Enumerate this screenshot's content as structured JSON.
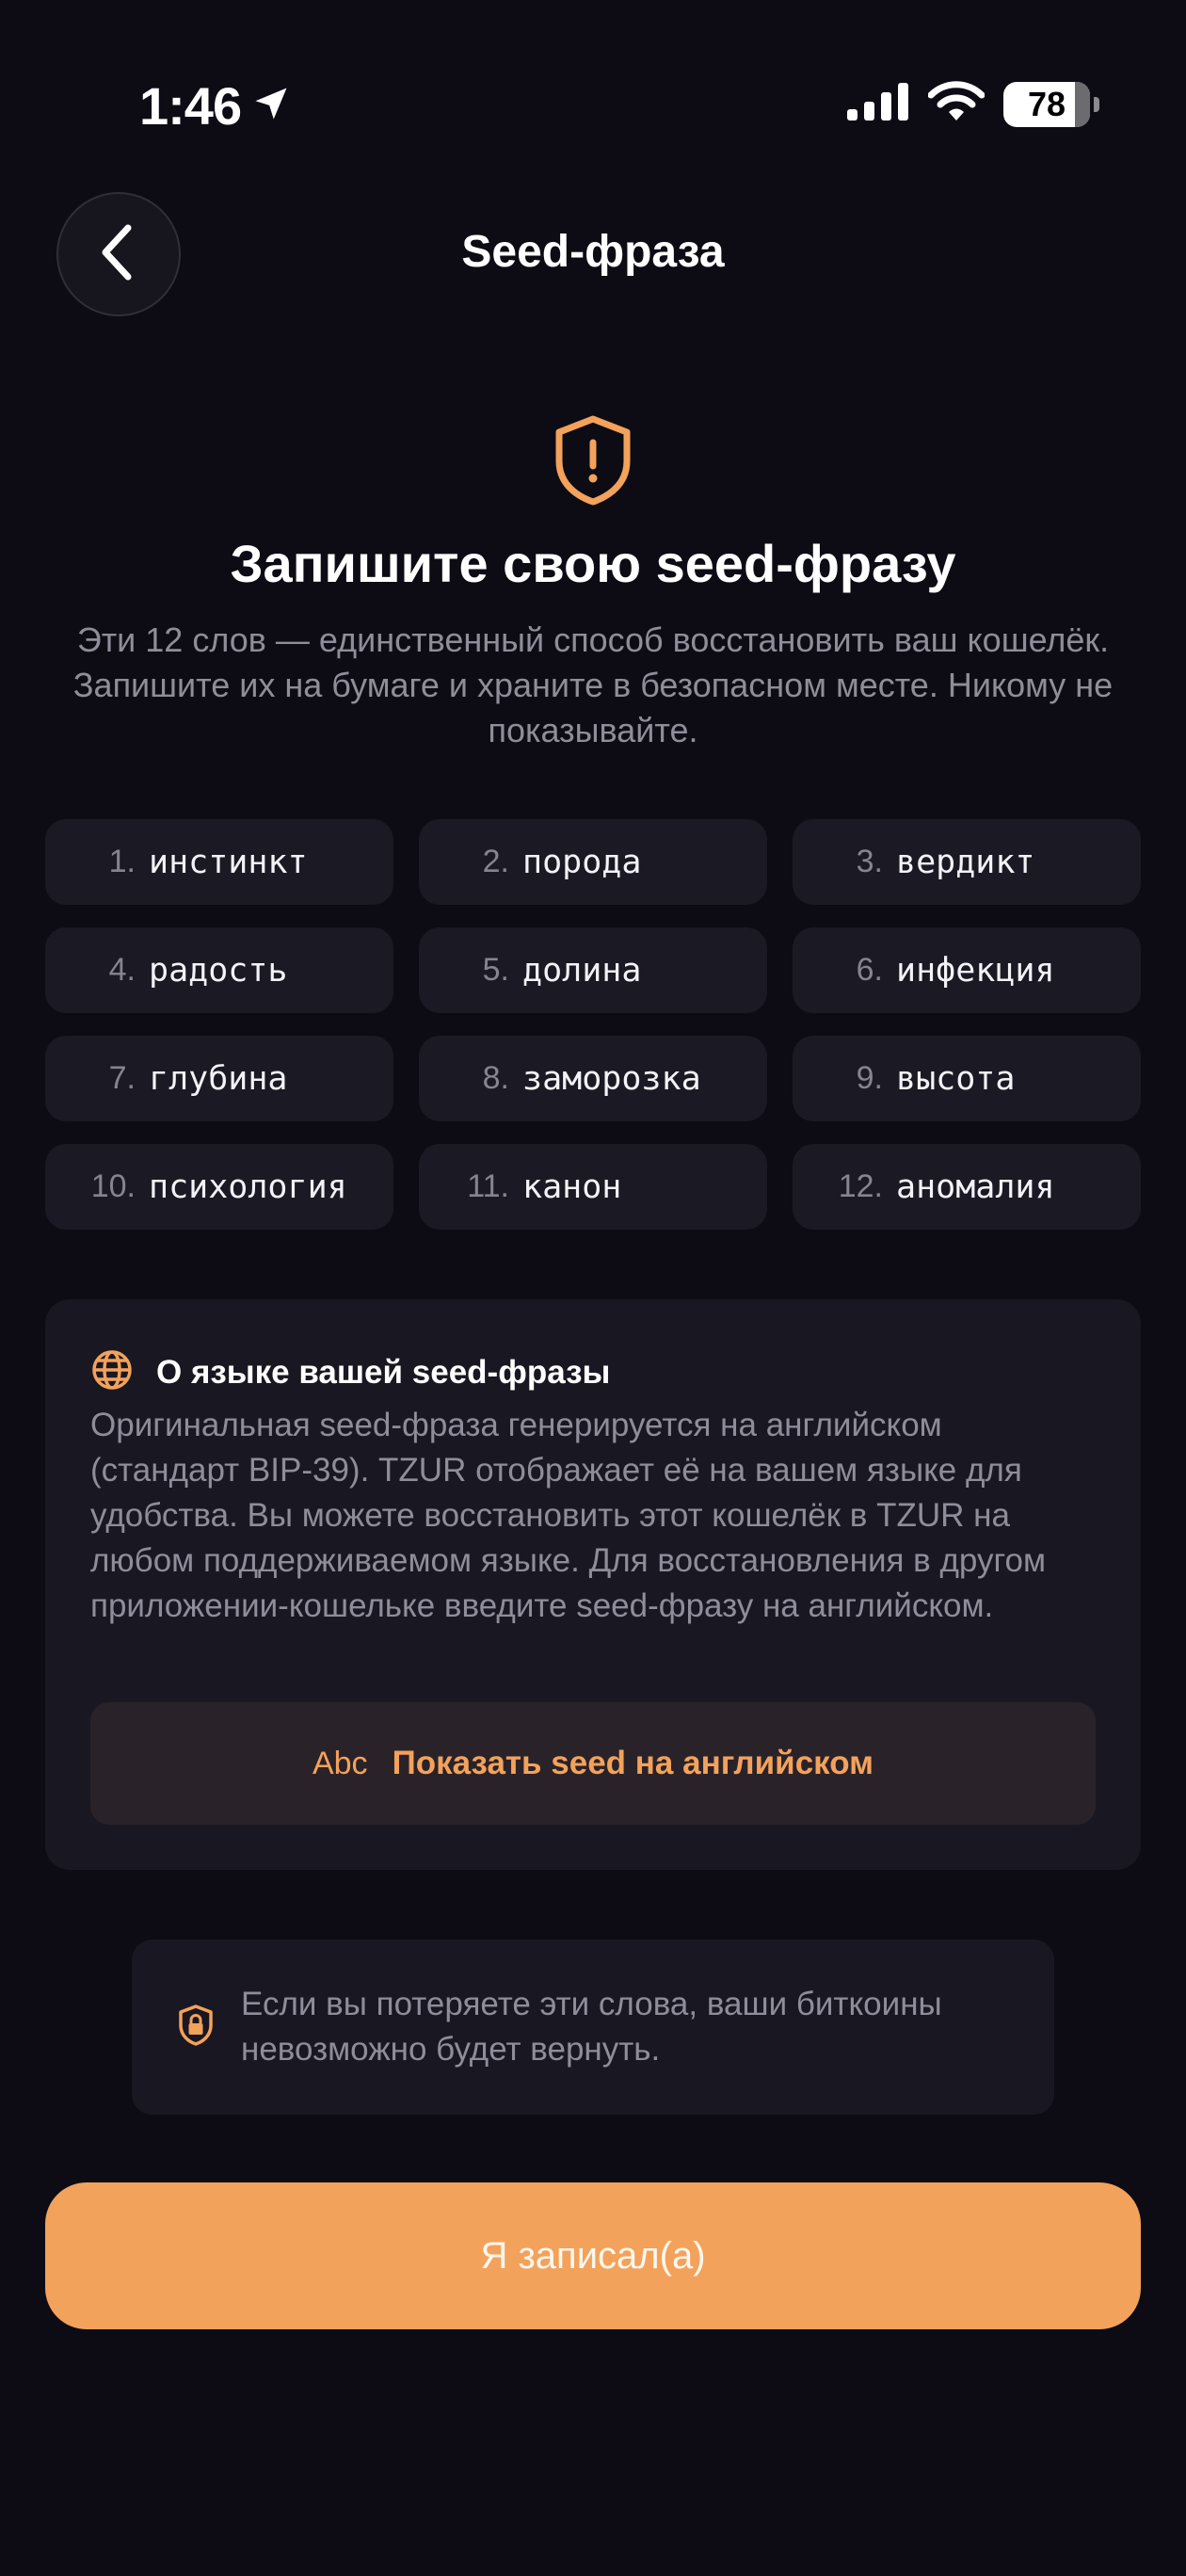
{
  "status_bar": {
    "time": "1:46",
    "battery": "78"
  },
  "header": {
    "title": "Seed-фраза"
  },
  "hero": {
    "headline": "Запишите свою seed-фразу",
    "subtext": "Эти 12 слов — единственный способ восстановить ваш кошелёк. Запишите их на бумаге и храните в безопасном месте. Никому не показывайте."
  },
  "words": [
    {
      "num": "1.",
      "word": "инстинкт"
    },
    {
      "num": "2.",
      "word": "порода"
    },
    {
      "num": "3.",
      "word": "вердикт"
    },
    {
      "num": "4.",
      "word": "радость"
    },
    {
      "num": "5.",
      "word": "долина"
    },
    {
      "num": "6.",
      "word": "инфекция"
    },
    {
      "num": "7.",
      "word": "глубина"
    },
    {
      "num": "8.",
      "word": "заморозка"
    },
    {
      "num": "9.",
      "word": "высота"
    },
    {
      "num": "10.",
      "word": "психология"
    },
    {
      "num": "11.",
      "word": "канон"
    },
    {
      "num": "12.",
      "word": "аномалия"
    }
  ],
  "info_card": {
    "title": "О языке вашей seed-фразы",
    "body": "Оригинальная seed-фраза генерируется на английском (стандарт BIP-39). TZUR отображает её на вашем языке для удобства. Вы можете восстановить этот кошелёк в TZUR на любом поддерживаемом языке. Для восстановления в другом приложении-кошельке введите seed-фразу на английском.",
    "button_icon": "Abc",
    "button_label": "Показать seed на английском"
  },
  "warning": {
    "text": "Если вы потеряете эти слова, ваши биткоины невозможно будет вернуть."
  },
  "primary_button": {
    "label": "Я записал(а)"
  },
  "colors": {
    "background": "#0d0c15",
    "card": "#1a1924",
    "accent": "#f3a25b",
    "muted_text": "#8e8d99"
  },
  "icons": [
    "location-arrow-icon",
    "signal-icon",
    "wifi-icon",
    "battery-icon",
    "back-chevron-icon",
    "shield-alert-icon",
    "globe-icon",
    "lock-shield-icon"
  ]
}
